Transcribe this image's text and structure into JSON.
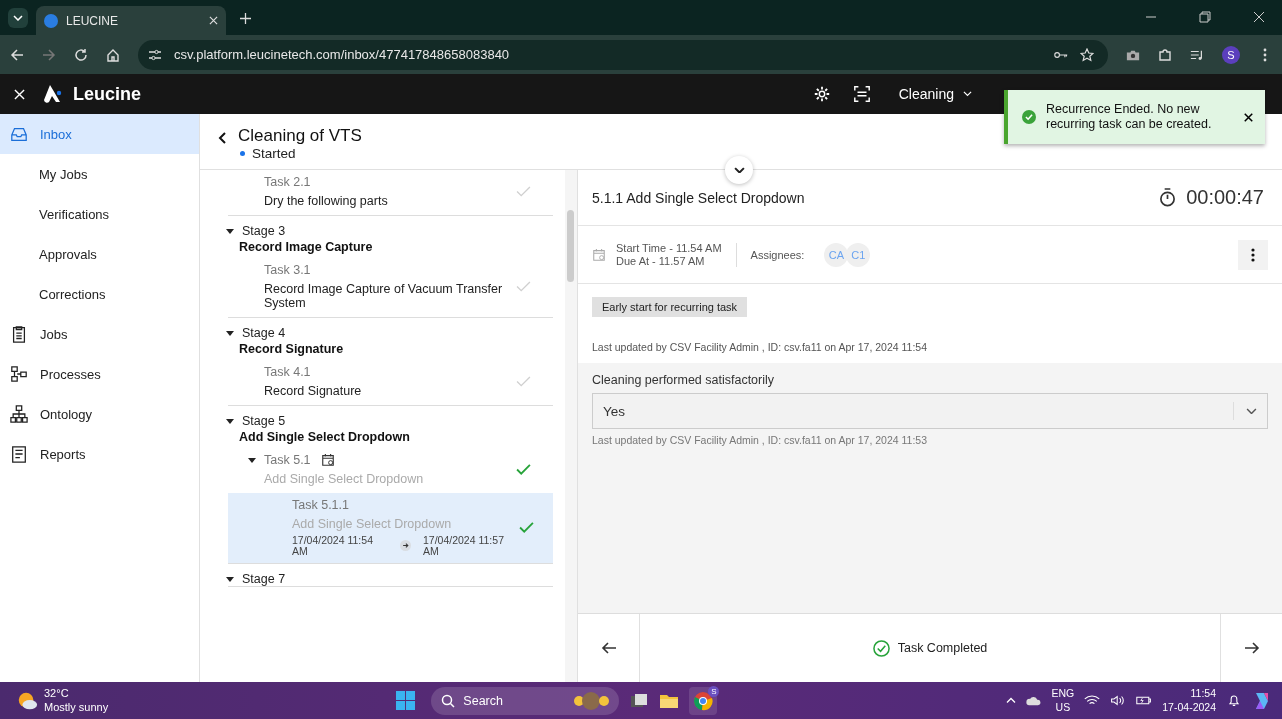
{
  "browser": {
    "tab_title": "LEUCINE",
    "url": "csv.platform.leucinetech.com/inbox/477417848658083840",
    "profile": "S"
  },
  "app_header": {
    "brand": "Leucine",
    "facility": "Cleaning"
  },
  "toast": {
    "message": "Recurrence Ended. No new recurring task can be created."
  },
  "sidebar": {
    "items": [
      {
        "label": "Inbox",
        "kind": "inbox",
        "selected": true,
        "children": [
          {
            "label": "My Jobs",
            "selected": false
          },
          {
            "label": "Verifications",
            "selected": false
          },
          {
            "label": "Approvals",
            "selected": false
          },
          {
            "label": "Corrections",
            "selected": false
          }
        ]
      },
      {
        "label": "Jobs",
        "kind": "jobs",
        "selected": false
      },
      {
        "label": "Processes",
        "kind": "processes",
        "selected": false
      },
      {
        "label": "Ontology",
        "kind": "ontology",
        "selected": false
      },
      {
        "label": "Reports",
        "kind": "reports",
        "selected": false
      }
    ]
  },
  "job": {
    "title": "Cleaning of VTS",
    "status": "Started"
  },
  "stages": [
    {
      "tasks": [
        {
          "label": "Task 2.1",
          "name": "Dry the following parts",
          "completed": false,
          "selected": false
        }
      ]
    },
    {
      "label": "Stage 3",
      "title": "Record Image Capture",
      "expanded": true,
      "tasks": [
        {
          "label": "Task 3.1",
          "name": "Record Image Capture of Vacuum Transfer System",
          "completed": false,
          "selected": false
        }
      ]
    },
    {
      "label": "Stage 4",
      "title": "Record Signature",
      "expanded": true,
      "tasks": [
        {
          "label": "Task 4.1",
          "name": "Record Signature",
          "completed": false,
          "selected": false
        }
      ]
    },
    {
      "label": "Stage 5",
      "title": "Add Single Select Dropdown",
      "expanded": true,
      "tasks": [
        {
          "label": "Task 5.1",
          "name": "Add Single Select Dropdown",
          "completed": true,
          "selected": false,
          "recurring": true,
          "expanded": true,
          "children": [
            {
              "label": "Task 5.1.1",
              "name": "Add Single Select Dropdown",
              "completed": true,
              "selected": true,
              "start": "17/04/2024 11:54 AM",
              "end": "17/04/2024 11:57 AM"
            }
          ]
        }
      ]
    },
    {
      "label": "Stage 7",
      "expanded": true
    }
  ],
  "task": {
    "title": "5.1.1 Add Single Select Dropdown",
    "timer": "00:00:47",
    "start_time": "Start Time - 11.54 AM",
    "due_at": "Due At - 11.57 AM",
    "assignees_label": "Assignees:",
    "assignees": [
      "CA",
      "C1"
    ],
    "badge": "Early start for recurring task",
    "updated": "Last updated by CSV Facility Admin , ID: csv.fa11 on Apr 17, 2024 11:54",
    "parameter": {
      "label": "Cleaning performed satisfactorily",
      "value": "Yes",
      "updated": "Last updated by CSV Facility Admin , ID: csv.fa11 on Apr 17, 2024 11:53"
    },
    "footer_status": "Task Completed"
  },
  "taskbar": {
    "temperature": "32°C",
    "weather": "Mostly sunny",
    "search": "Search",
    "chrome_badge": "S",
    "language": "ENG",
    "region": "US",
    "time": "11:54",
    "date": "17-04-2024"
  }
}
